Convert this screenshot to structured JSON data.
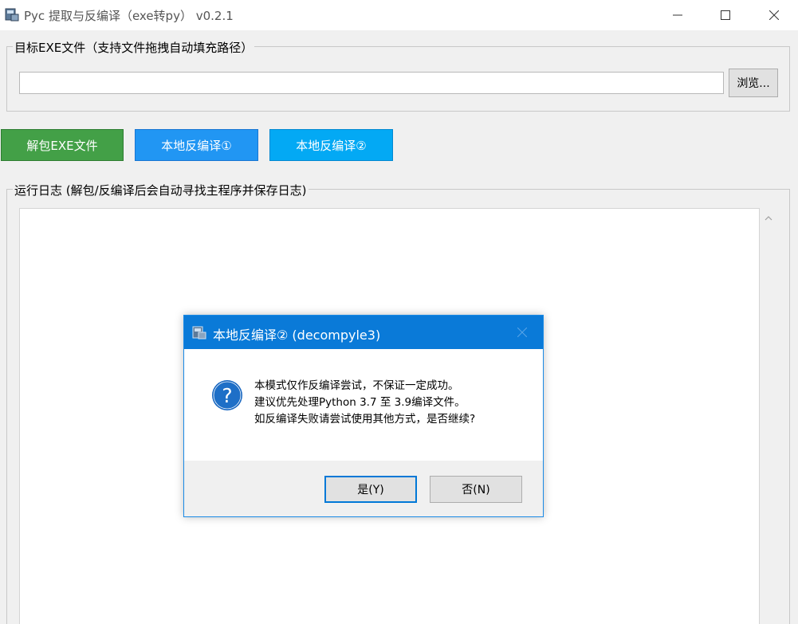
{
  "window": {
    "title": "Pyc 提取与反编译（exe转py） v0.2.1",
    "controls": [
      "minimize-icon",
      "maximize-icon",
      "close-icon"
    ]
  },
  "target_group": {
    "label": "目标EXE文件（支持文件拖拽自动填充路径）",
    "path_value": "",
    "browse_label": "浏览..."
  },
  "actions": {
    "unpack_label": "解包EXE文件",
    "decompile1_label": "本地反编译①",
    "decompile2_label": "本地反编译②"
  },
  "log_group": {
    "label": "运行日志 (解包/反编译后会自动寻找主程序并保存日志)"
  },
  "dialog": {
    "title": "本地反编译② (decompyle3)",
    "icon": "question-icon",
    "message_lines": [
      "本模式仅作反编译尝试，不保证一定成功。",
      "建议优先处理Python 3.7 至 3.9编译文件。",
      "如反编译失败请尝试使用其他方式，是否继续?"
    ],
    "yes_label": "是(Y)",
    "no_label": "否(N)"
  },
  "colors": {
    "unpack_button": "#43a047",
    "decompile1_button": "#2196f3",
    "decompile2_button": "#03a9f4",
    "dialog_titlebar": "#0a7ad8",
    "question_icon": "#1565c0"
  }
}
